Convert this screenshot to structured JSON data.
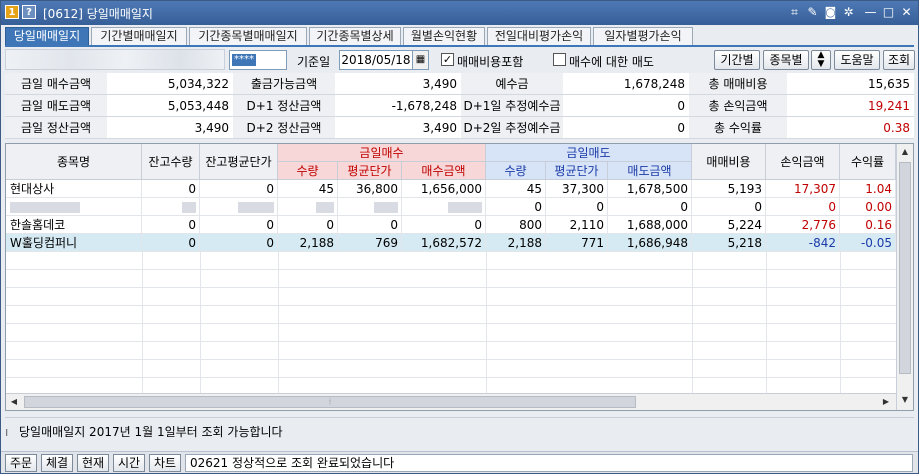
{
  "window": {
    "badge1": "1",
    "badge2": "?",
    "title": "[0612] 당일매매일지"
  },
  "tabs": [
    {
      "label": "당일매매일지",
      "active": true
    },
    {
      "label": "기간별매매일지"
    },
    {
      "label": "기간종목별매매일지"
    },
    {
      "label": "기간종목별상세"
    },
    {
      "label": "월별손익현황"
    },
    {
      "label": "전일대비평가손익"
    },
    {
      "label": "일자별평가손익"
    }
  ],
  "controls": {
    "password_mask": "****",
    "date_label": "기준일",
    "date_value": "2018/05/18",
    "include_fee_label": "매매비용포함",
    "include_fee_checked": true,
    "per_stock_sell_label": "매수에 대한 매도",
    "per_stock_sell_checked": false,
    "btn_period": "기간별",
    "btn_stock": "종목별",
    "btn_help": "도움말",
    "btn_query": "조회"
  },
  "summary": {
    "row1": [
      {
        "label": "금일 매수금액",
        "value": "5,034,322"
      },
      {
        "label": "출금가능금액",
        "value": "3,490"
      },
      {
        "label": "예수금",
        "value": "1,678,248"
      },
      {
        "label": "총 매매비용",
        "value": "15,635"
      }
    ],
    "row2": [
      {
        "label": "금일 매도금액",
        "value": "5,053,448"
      },
      {
        "label": "D+1 정산금액",
        "value": "-1,678,248"
      },
      {
        "label": "D+1일 추정예수금",
        "value": "0"
      },
      {
        "label": "총 손익금액",
        "value": "19,241"
      }
    ],
    "row3": [
      {
        "label": "금일 정산금액",
        "value": "3,490"
      },
      {
        "label": "D+2 정산금액",
        "value": "3,490"
      },
      {
        "label": "D+2일 추정예수금",
        "value": "0"
      },
      {
        "label": "총 수익률",
        "value": "0.38"
      }
    ]
  },
  "table": {
    "headers": {
      "name": "종목명",
      "hold_qty": "잔고수량",
      "hold_avg": "잔고평균단가",
      "buy_group": "금일매수",
      "buy_qty": "수량",
      "buy_avg": "평균단가",
      "buy_amt": "매수금액",
      "sell_group": "금일매도",
      "sell_qty": "수량",
      "sell_avg": "평균단가",
      "sell_amt": "매도금액",
      "fee": "매매비용",
      "pnl": "손익금액",
      "rate": "수익률"
    },
    "rows": [
      {
        "name": "현대상사",
        "hold_qty": "0",
        "hold_avg": "0",
        "buy_qty": "45",
        "buy_avg": "36,800",
        "buy_amt": "1,656,000",
        "sell_qty": "45",
        "sell_avg": "37,300",
        "sell_amt": "1,678,500",
        "fee": "5,193",
        "pnl": "17,307",
        "rate": "1.04",
        "sign": "pos"
      },
      {
        "name": "",
        "hold_qty": "",
        "hold_avg": "",
        "buy_qty": "",
        "buy_avg": "",
        "buy_amt": "",
        "sell_qty": "0",
        "sell_avg": "0",
        "sell_amt": "0",
        "fee": "0",
        "pnl": "0",
        "rate": "0.00",
        "sign": "pos",
        "masked": true
      },
      {
        "name": "한솔홈데코",
        "hold_qty": "0",
        "hold_avg": "0",
        "buy_qty": "0",
        "buy_avg": "0",
        "buy_amt": "0",
        "sell_qty": "800",
        "sell_avg": "2,110",
        "sell_amt": "1,688,000",
        "fee": "5,224",
        "pnl": "2,776",
        "rate": "0.16",
        "sign": "pos"
      },
      {
        "name": "W홀딩컴퍼니",
        "hold_qty": "0",
        "hold_avg": "0",
        "buy_qty": "2,188",
        "buy_avg": "769",
        "buy_amt": "1,682,572",
        "sell_qty": "2,188",
        "sell_avg": "771",
        "sell_amt": "1,686,948",
        "fee": "5,218",
        "pnl": "-842",
        "rate": "-0.05",
        "sign": "neg",
        "selected": true
      }
    ]
  },
  "message": "당일매매일지 2017년 1월 1일부터 조회 가능합니다",
  "statusbar": {
    "buttons": [
      "주문",
      "체결",
      "현재",
      "시간",
      "차트"
    ],
    "message": "02621 정상적으로 조회 완료되었습니다"
  },
  "colors": {
    "accent": "#3e76b8",
    "buy_header": "#f7d7d7",
    "sell_header": "#d7e4f7",
    "selected_row": "#d6eaf3",
    "positive": "#c00000",
    "negative": "#1a3aa8"
  }
}
